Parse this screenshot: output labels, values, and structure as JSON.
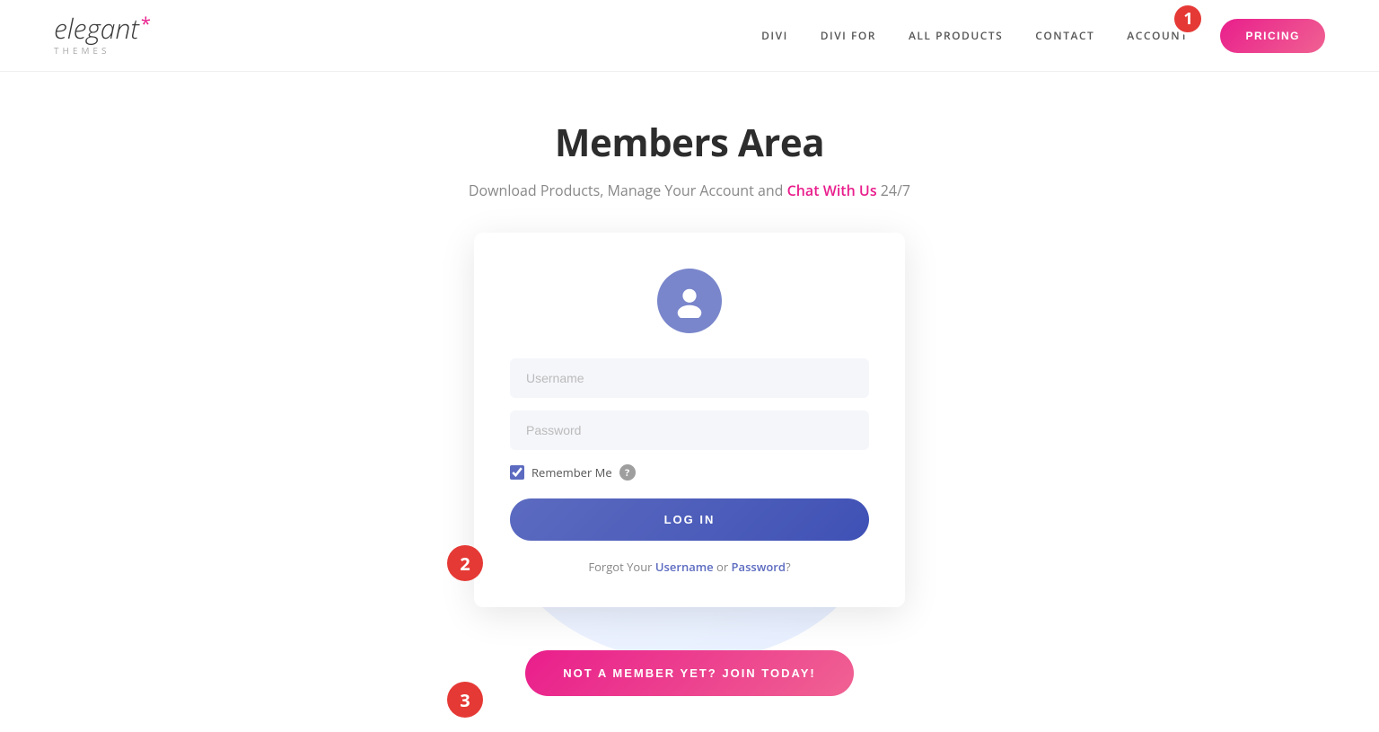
{
  "header": {
    "logo": {
      "word": "elegant",
      "asterisk": "*",
      "subtext": "themes"
    },
    "nav": {
      "items": [
        {
          "label": "DIVI",
          "id": "divi"
        },
        {
          "label": "DIVI FOR",
          "id": "divi-for"
        },
        {
          "label": "ALL PRODUCTS",
          "id": "all-products"
        },
        {
          "label": "CONTACT",
          "id": "contact"
        },
        {
          "label": "ACCOUNT",
          "id": "account"
        }
      ],
      "badge": "1",
      "pricing_label": "PRICING"
    }
  },
  "main": {
    "title": "Members Area",
    "subtitle_prefix": "Download Products, Manage Your Account and ",
    "chat_link_text": "Chat With Us",
    "subtitle_suffix": " 24/7"
  },
  "login_form": {
    "username_placeholder": "Username",
    "password_placeholder": "Password",
    "remember_me_label": "Remember Me",
    "login_button": "LOG IN",
    "forgot_prefix": "Forgot Your ",
    "username_link": "Username",
    "forgot_or": " or ",
    "password_link": "Password",
    "forgot_suffix": "?"
  },
  "join_banner": {
    "label": "NOT A MEMBER YET? JOIN TODAY!"
  },
  "annotations": {
    "badge_1": "1",
    "badge_2": "2",
    "badge_3": "3"
  },
  "colors": {
    "pink": "#e91e8c",
    "blue": "#3f51b5",
    "blue_mid": "#5c6bc0",
    "avatar_bg": "#7986cb",
    "red_badge": "#e53935"
  }
}
